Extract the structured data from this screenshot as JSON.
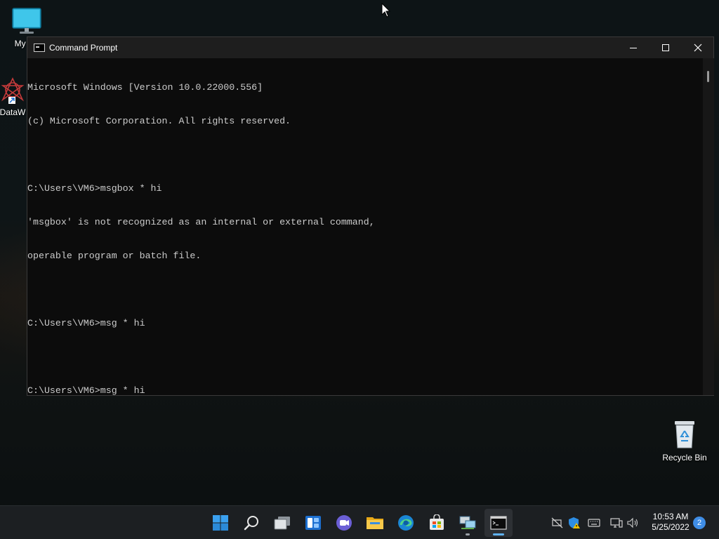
{
  "desktop": {
    "icons": [
      {
        "label": "My Co"
      },
      {
        "label": "DataW"
      },
      {
        "label": "Recycle Bin"
      }
    ]
  },
  "window": {
    "title": "Command Prompt",
    "console_lines": [
      "Microsoft Windows [Version 10.0.22000.556]",
      "(c) Microsoft Corporation. All rights reserved.",
      "",
      "C:\\Users\\VM6>msgbox * hi",
      "'msgbox' is not recognized as an internal or external command,",
      "operable program or batch file.",
      "",
      "C:\\Users\\VM6>msg * hi",
      "",
      "C:\\Users\\VM6>msg * hi"
    ]
  },
  "taskbar": {
    "apps": [
      {
        "name": "start",
        "icon": "windows-logo-icon"
      },
      {
        "name": "search",
        "icon": "search-icon"
      },
      {
        "name": "task-view",
        "icon": "task-view-icon"
      },
      {
        "name": "widgets",
        "icon": "widgets-icon"
      },
      {
        "name": "chat",
        "icon": "chat-icon"
      },
      {
        "name": "file-explorer",
        "icon": "folder-icon"
      },
      {
        "name": "edge",
        "icon": "edge-icon"
      },
      {
        "name": "store",
        "icon": "store-icon"
      },
      {
        "name": "network-app",
        "icon": "network-app-icon"
      },
      {
        "name": "command-prompt",
        "icon": "cmd-icon",
        "active": true
      }
    ],
    "tray": {
      "time": "10:53 AM",
      "date": "5/25/2022",
      "notifications": "2"
    }
  },
  "colors": {
    "console_bg": "#0c0c0c",
    "console_text": "#cccccc",
    "taskbar_bg": "#1c1f22",
    "accent": "#5fb2f2"
  }
}
